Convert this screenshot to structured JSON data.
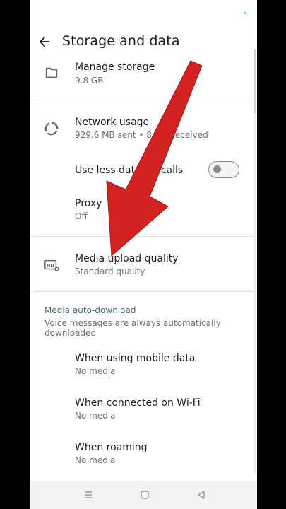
{
  "header": {
    "title": "Storage and data"
  },
  "storage": {
    "manage_title": "Manage storage",
    "manage_size": "9.8 GB"
  },
  "network": {
    "usage_title": "Network usage",
    "usage_detail": "929.6 MB sent • 8.2 G received",
    "less_data_label": "Use less data for calls",
    "less_data_enabled": false,
    "proxy_title": "Proxy",
    "proxy_value": "Off"
  },
  "media_quality": {
    "title": "Media upload quality",
    "value": "Standard quality"
  },
  "auto_download": {
    "header": "Media auto-download",
    "subtitle": "Voice messages are always automatically downloaded",
    "items": [
      {
        "label": "When using mobile data",
        "value": "No media"
      },
      {
        "label": "When connected on Wi-Fi",
        "value": "No media"
      },
      {
        "label": "When roaming",
        "value": "No media"
      }
    ]
  },
  "colors": {
    "arrow": "#d32222",
    "status_dot": "#25d0b6",
    "toggle_off": "#8a8a8a"
  },
  "icons": {
    "back": "arrow-left-icon",
    "storage": "folder-icon",
    "network": "data-usage-icon",
    "media": "hd-settings-icon",
    "nav": [
      "menu-icon",
      "home-icon",
      "back-triangle-icon"
    ]
  }
}
